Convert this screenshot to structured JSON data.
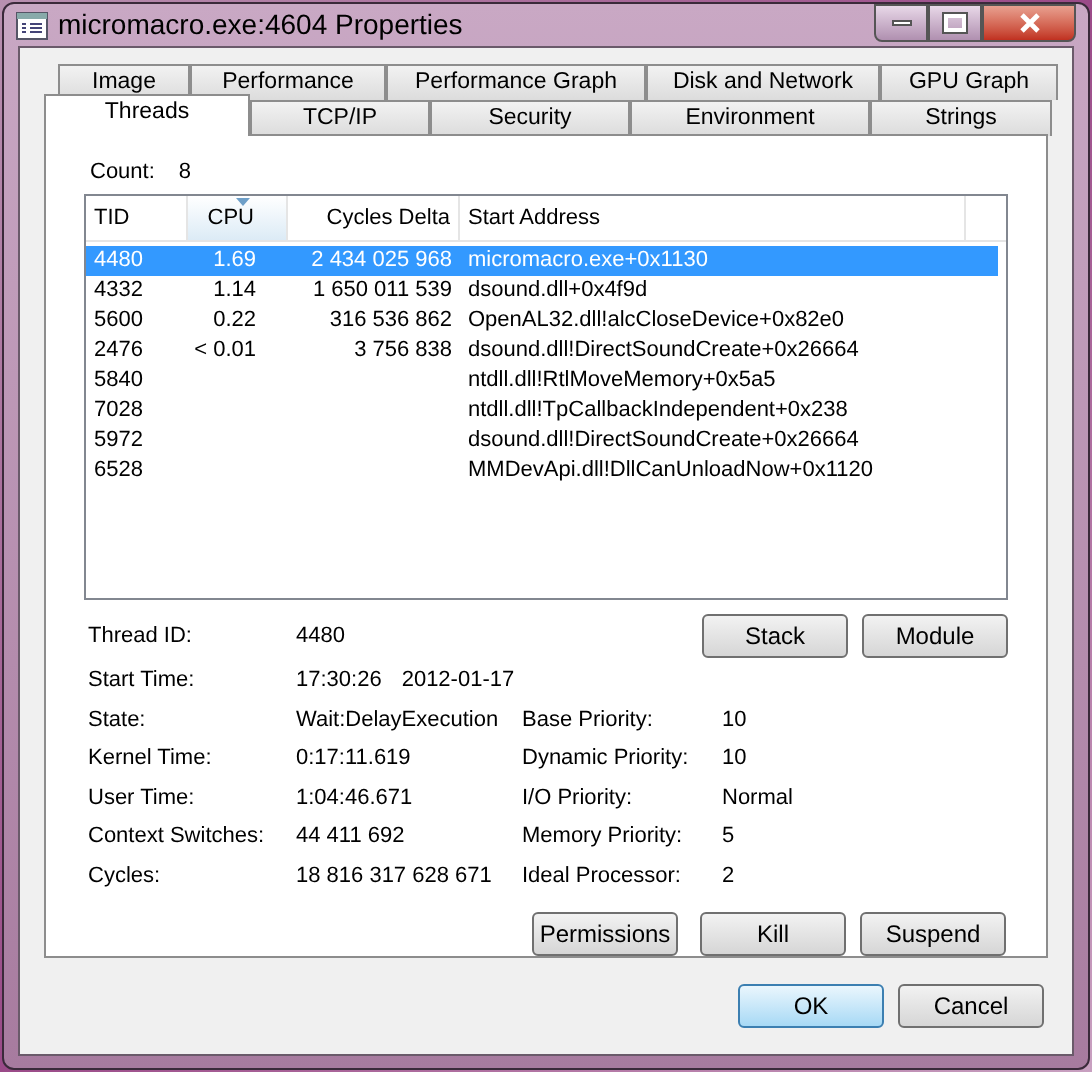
{
  "window": {
    "title": "micromacro.exe:4604 Properties"
  },
  "tab_rows": [
    [
      {
        "label": "Image",
        "selected": false
      },
      {
        "label": "Performance",
        "selected": false
      },
      {
        "label": "Performance Graph",
        "selected": false
      },
      {
        "label": "Disk and Network",
        "selected": false
      },
      {
        "label": "GPU Graph",
        "selected": false
      }
    ],
    [
      {
        "label": "Threads",
        "selected": true
      },
      {
        "label": "TCP/IP",
        "selected": false
      },
      {
        "label": "Security",
        "selected": false
      },
      {
        "label": "Environment",
        "selected": false
      },
      {
        "label": "Strings",
        "selected": false
      }
    ]
  ],
  "count": {
    "label": "Count:",
    "value": "8"
  },
  "table": {
    "columns": [
      {
        "label": "TID",
        "sorted": false
      },
      {
        "label": "CPU",
        "sorted": true
      },
      {
        "label": "Cycles Delta",
        "sorted": false
      },
      {
        "label": "Start Address",
        "sorted": false
      }
    ],
    "rows": [
      {
        "cells": [
          "4480",
          "1.69",
          "2 434 025 968",
          "micromacro.exe+0x1130"
        ],
        "selected": true
      },
      {
        "cells": [
          "4332",
          "1.14",
          "1 650 011 539",
          "dsound.dll+0x4f9d"
        ],
        "selected": false
      },
      {
        "cells": [
          "5600",
          "0.22",
          "316 536 862",
          "OpenAL32.dll!alcCloseDevice+0x82e0"
        ],
        "selected": false
      },
      {
        "cells": [
          "2476",
          "< 0.01",
          "3 756 838",
          "dsound.dll!DirectSoundCreate+0x26664"
        ],
        "selected": false
      },
      {
        "cells": [
          "5840",
          "",
          "",
          "ntdll.dll!RtlMoveMemory+0x5a5"
        ],
        "selected": false
      },
      {
        "cells": [
          "7028",
          "",
          "",
          "ntdll.dll!TpCallbackIndependent+0x238"
        ],
        "selected": false
      },
      {
        "cells": [
          "5972",
          "",
          "",
          "dsound.dll!DirectSoundCreate+0x26664"
        ],
        "selected": false
      },
      {
        "cells": [
          "6528",
          "",
          "",
          "MMDevApi.dll!DllCanUnloadNow+0x1120"
        ],
        "selected": false
      }
    ]
  },
  "details": {
    "thread_id": {
      "label": "Thread ID:",
      "value": "4480"
    },
    "start_time": {
      "label": "Start Time:",
      "time": "17:30:26",
      "date": "2012-01-17"
    },
    "left": [
      {
        "label": "State:",
        "value": "Wait:DelayExecution"
      },
      {
        "label": "Kernel Time:",
        "value": "0:17:11.619"
      },
      {
        "label": "User Time:",
        "value": "1:04:46.671"
      },
      {
        "label": "Context Switches:",
        "value": "44 411 692"
      },
      {
        "label": "Cycles:",
        "value": "18 816 317 628 671"
      }
    ],
    "right": [
      {
        "label": "Base Priority:",
        "value": "10"
      },
      {
        "label": "Dynamic Priority:",
        "value": "10"
      },
      {
        "label": "I/O Priority:",
        "value": "Normal"
      },
      {
        "label": "Memory Priority:",
        "value": "5"
      },
      {
        "label": "Ideal Processor:",
        "value": "2"
      }
    ]
  },
  "top_buttons": [
    {
      "label": "Stack"
    },
    {
      "label": "Module"
    }
  ],
  "bottom_buttons": [
    {
      "label": "Permissions"
    },
    {
      "label": "Kill"
    },
    {
      "label": "Suspend"
    }
  ],
  "dialog_buttons": [
    {
      "label": "OK",
      "default": true
    },
    {
      "label": "Cancel",
      "default": false
    }
  ]
}
